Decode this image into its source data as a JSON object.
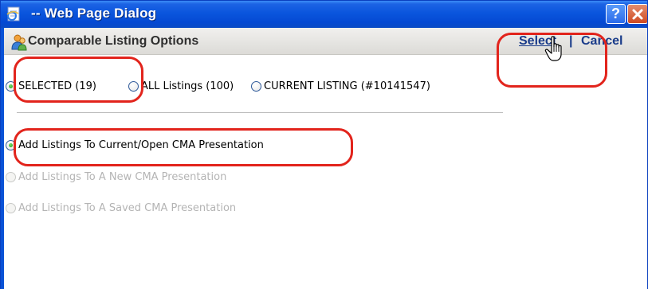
{
  "window": {
    "title": "-- Web Page Dialog",
    "help_label": "?",
    "accent": "#0a55dd"
  },
  "dialog": {
    "heading": "Comparable Listing Options",
    "select_label": "Select",
    "separator": "|",
    "cancel_label": "Cancel"
  },
  "scope_options": [
    {
      "label": "SELECTED (19)",
      "checked": true
    },
    {
      "label": "ALL Listings (100)",
      "checked": false
    },
    {
      "label": "CURRENT LISTING (#10141547)",
      "checked": false
    }
  ],
  "action_options": [
    {
      "label": "Add Listings To Current/Open CMA Presentation",
      "checked": true,
      "enabled": true
    },
    {
      "label": "Add Listings To A New CMA Presentation",
      "checked": false,
      "enabled": false
    },
    {
      "label": "Add Listings To A Saved CMA Presentation",
      "checked": false,
      "enabled": false
    }
  ],
  "annotation_color": "#e2241c"
}
